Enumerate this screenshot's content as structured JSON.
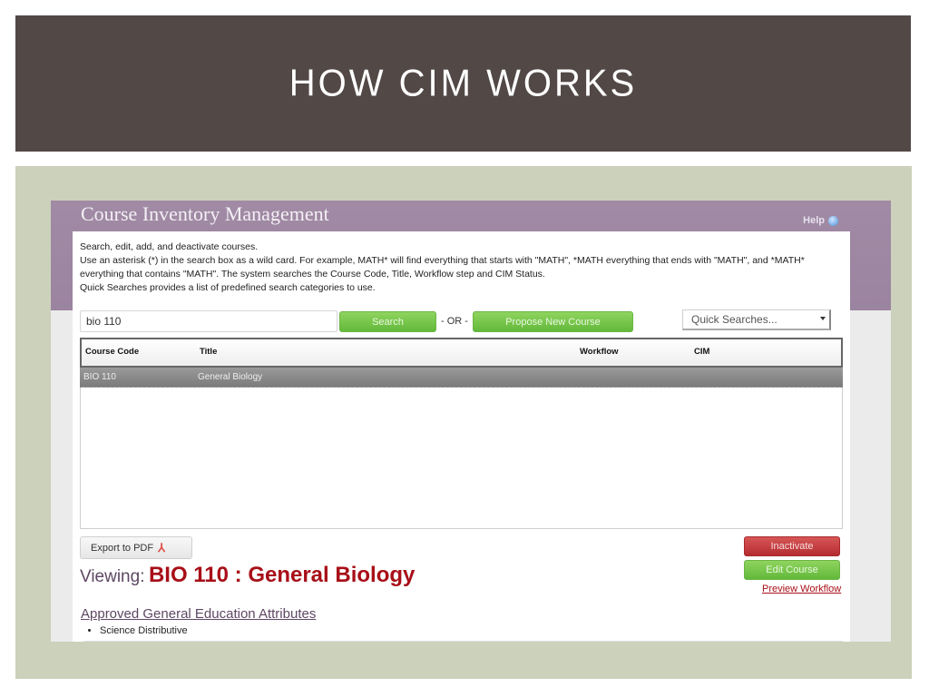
{
  "slide": {
    "title": "HOW CIM WORKS",
    "colors": {
      "title_band": "#524846",
      "content_band": "#ccd1bb"
    }
  },
  "app": {
    "title": "Course Inventory Management",
    "help_label": "Help",
    "help_icon": "help-circle-icon",
    "description": [
      "Search, edit, add, and deactivate courses.",
      "Use an asterisk (*) in the search box as a wild card. For example, MATH* will find everything that starts with \"MATH\", *MATH everything that ends with \"MATH\", and *MATH* everything that contains \"MATH\". The system searches the Course Code, Title, Workflow step and CIM Status.",
      "Quick Searches provides a list of predefined search categories to use."
    ],
    "search": {
      "value": "bio 110",
      "button_label": "Search",
      "or_label": "- OR -",
      "propose_label": "Propose New Course",
      "quick_searches": "Quick Searches..."
    },
    "table": {
      "columns": [
        "Course Code",
        "Title",
        "Workflow",
        "CIM"
      ],
      "rows": [
        {
          "code": "BIO 110",
          "title": "General Biology",
          "workflow": "",
          "cim": ""
        }
      ]
    },
    "export_label": "Export to PDF",
    "export_icon": "pdf-icon",
    "viewing": {
      "label": "Viewing:",
      "value": "BIO 110 : General Biology"
    },
    "actions": {
      "inactivate": "Inactivate",
      "edit": "Edit Course",
      "preview": "Preview Workflow"
    },
    "gen_ed": {
      "heading": "Approved General Education Attributes",
      "items": [
        "Science Distributive"
      ]
    },
    "colors": {
      "header": "#9b84a0",
      "green_button": "#62b93a",
      "red_button": "#b52c30",
      "accent_red": "#a80f18"
    }
  }
}
